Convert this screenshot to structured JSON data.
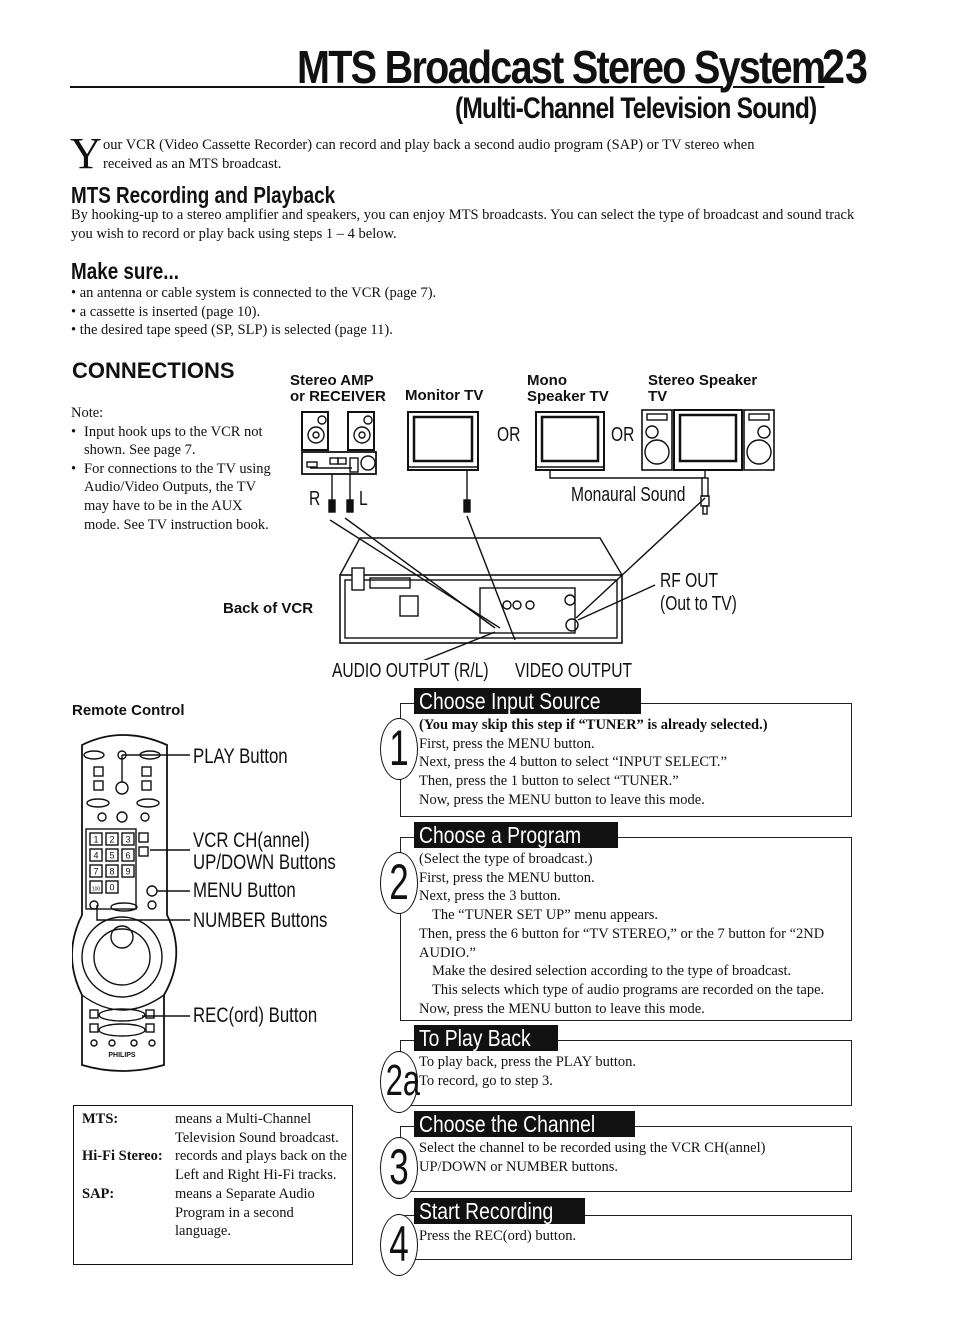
{
  "header": {
    "title": "MTS Broadcast Stereo System",
    "page_number": "23",
    "subtitle": "(Multi-Channel Television Sound)"
  },
  "intro": {
    "dropcap": "Y",
    "text_line1": "our VCR (Video Cassette Recorder) can record and play back a second audio program (SAP) or TV stereo when",
    "text_line2": "received as an MTS broadcast."
  },
  "mts_section": {
    "heading": "MTS Recording and Playback",
    "body": "By hooking-up to a stereo amplifier and speakers, you can enjoy MTS broadcasts. You can select the type of broadcast and sound track you wish to record or play back using steps 1 – 4 below."
  },
  "make_sure": {
    "heading": "Make sure...",
    "items": [
      "an antenna or cable system is connected to the VCR (page 7).",
      "a cassette is inserted (page 10).",
      "the desired tape speed (SP, SLP) is selected (page 11)."
    ]
  },
  "connections": {
    "heading": "CONNECTIONS",
    "note_label": "Note:",
    "notes": [
      "Input hook ups to the VCR not shown. See page 7.",
      "For connections to the TV using Audio/Video Outputs, the TV may have to be in the AUX mode. See TV instruction book."
    ],
    "back_of_vcr": "Back of VCR",
    "devices": {
      "amp_line1": "Stereo AMP",
      "amp_line2": "or RECEIVER",
      "monitor_tv": "Monitor TV",
      "mono_line1": "Mono",
      "mono_line2": "Speaker TV",
      "stereo_line1": "Stereo Speaker",
      "stereo_line2": "TV"
    },
    "or_1": "OR",
    "or_2": "OR",
    "right_label": "R",
    "left_label": "L",
    "monaural_sound": "Monaural Sound",
    "rf_out_line1": "RF OUT",
    "rf_out_line2": "(Out to TV)",
    "audio_output": "AUDIO OUTPUT (R/L)",
    "video_output": "VIDEO OUTPUT"
  },
  "remote": {
    "label": "Remote Control",
    "brand": "PHILIPS",
    "keypad": [
      "1",
      "2",
      "3",
      "4",
      "5",
      "6",
      "7",
      "8",
      "9",
      "100",
      "0"
    ],
    "callouts": {
      "play": "PLAY Button",
      "ch_line1": "VCR CH(annel)",
      "ch_line2": "UP/DOWN Buttons",
      "menu": "MENU Button",
      "number": "NUMBER Buttons",
      "rec": "REC(ord) Button"
    }
  },
  "glossary": [
    {
      "term": "MTS:",
      "definition": "means a Multi-Channel Television Sound broadcast."
    },
    {
      "term": "Hi-Fi Stereo:",
      "definition": "records and plays back on the Left and Right Hi-Fi tracks."
    },
    {
      "term": "SAP:",
      "definition": "means a Separate Audio Program in a second language."
    }
  ],
  "steps": [
    {
      "number": "1",
      "title": "Choose Input Source",
      "lines": [
        {
          "text": "(You may skip this step if “TUNER” is already selected.)",
          "style": "bold"
        },
        {
          "text": "First, press the MENU button.",
          "style": ""
        },
        {
          "text": "Next, press the 4 button to select “INPUT SELECT.”",
          "style": ""
        },
        {
          "text": "Then, press the 1 button to select “TUNER.”",
          "style": ""
        },
        {
          "text": "Now, press the MENU button to leave this mode.",
          "style": ""
        }
      ]
    },
    {
      "number": "2",
      "title": "Choose a Program",
      "lines": [
        {
          "text": "(Select the type of broadcast.)",
          "style": ""
        },
        {
          "text": "First, press the MENU button.",
          "style": ""
        },
        {
          "text": "Next, press the 3 button.",
          "style": ""
        },
        {
          "text": "The “TUNER SET UP” menu appears.",
          "style": "indent"
        },
        {
          "text": "Then, press the 6 button for “TV STEREO,” or the 7 button for “2ND",
          "style": ""
        },
        {
          "text": "AUDIO.”",
          "style": ""
        },
        {
          "text": "Make the desired selection according to the type of broadcast.",
          "style": "indent"
        },
        {
          "text": "This selects which type of audio programs are recorded on the tape.",
          "style": "indent"
        },
        {
          "text": "Now, press the MENU button to leave this mode.",
          "style": ""
        }
      ]
    },
    {
      "number": "2a",
      "title": "To Play Back",
      "lines": [
        {
          "text": "To play back, press the PLAY button.",
          "style": ""
        },
        {
          "text": "To record, go to step 3.",
          "style": ""
        }
      ]
    },
    {
      "number": "3",
      "title": "Choose the Channel",
      "lines": [
        {
          "text": "Select the channel to be recorded using the VCR CH(annel)",
          "style": ""
        },
        {
          "text": "UP/DOWN or NUMBER buttons.",
          "style": ""
        }
      ]
    },
    {
      "number": "4",
      "title": "Start Recording",
      "lines": [
        {
          "text": "Press the REC(ord) button.",
          "style": ""
        }
      ]
    }
  ]
}
